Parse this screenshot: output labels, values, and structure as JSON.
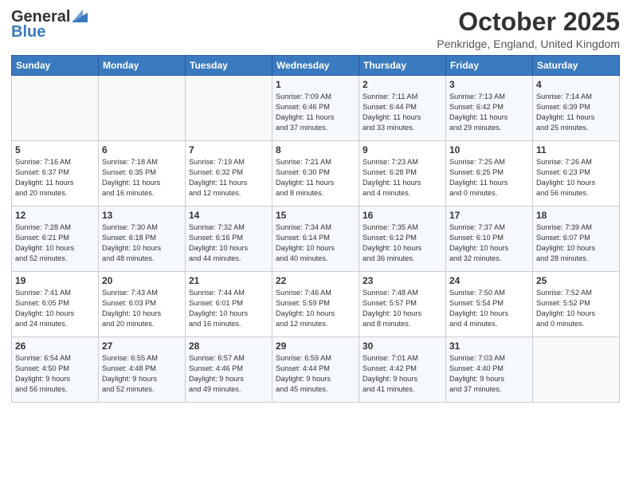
{
  "header": {
    "logo_general": "General",
    "logo_blue": "Blue",
    "month_title": "October 2025",
    "location": "Penkridge, England, United Kingdom"
  },
  "weekdays": [
    "Sunday",
    "Monday",
    "Tuesday",
    "Wednesday",
    "Thursday",
    "Friday",
    "Saturday"
  ],
  "weeks": [
    [
      {
        "day": "",
        "info": ""
      },
      {
        "day": "",
        "info": ""
      },
      {
        "day": "",
        "info": ""
      },
      {
        "day": "1",
        "info": "Sunrise: 7:09 AM\nSunset: 6:46 PM\nDaylight: 11 hours\nand 37 minutes."
      },
      {
        "day": "2",
        "info": "Sunrise: 7:11 AM\nSunset: 6:44 PM\nDaylight: 11 hours\nand 33 minutes."
      },
      {
        "day": "3",
        "info": "Sunrise: 7:13 AM\nSunset: 6:42 PM\nDaylight: 11 hours\nand 29 minutes."
      },
      {
        "day": "4",
        "info": "Sunrise: 7:14 AM\nSunset: 6:39 PM\nDaylight: 11 hours\nand 25 minutes."
      }
    ],
    [
      {
        "day": "5",
        "info": "Sunrise: 7:16 AM\nSunset: 6:37 PM\nDaylight: 11 hours\nand 20 minutes."
      },
      {
        "day": "6",
        "info": "Sunrise: 7:18 AM\nSunset: 6:35 PM\nDaylight: 11 hours\nand 16 minutes."
      },
      {
        "day": "7",
        "info": "Sunrise: 7:19 AM\nSunset: 6:32 PM\nDaylight: 11 hours\nand 12 minutes."
      },
      {
        "day": "8",
        "info": "Sunrise: 7:21 AM\nSunset: 6:30 PM\nDaylight: 11 hours\nand 8 minutes."
      },
      {
        "day": "9",
        "info": "Sunrise: 7:23 AM\nSunset: 6:28 PM\nDaylight: 11 hours\nand 4 minutes."
      },
      {
        "day": "10",
        "info": "Sunrise: 7:25 AM\nSunset: 6:25 PM\nDaylight: 11 hours\nand 0 minutes."
      },
      {
        "day": "11",
        "info": "Sunrise: 7:26 AM\nSunset: 6:23 PM\nDaylight: 10 hours\nand 56 minutes."
      }
    ],
    [
      {
        "day": "12",
        "info": "Sunrise: 7:28 AM\nSunset: 6:21 PM\nDaylight: 10 hours\nand 52 minutes."
      },
      {
        "day": "13",
        "info": "Sunrise: 7:30 AM\nSunset: 6:18 PM\nDaylight: 10 hours\nand 48 minutes."
      },
      {
        "day": "14",
        "info": "Sunrise: 7:32 AM\nSunset: 6:16 PM\nDaylight: 10 hours\nand 44 minutes."
      },
      {
        "day": "15",
        "info": "Sunrise: 7:34 AM\nSunset: 6:14 PM\nDaylight: 10 hours\nand 40 minutes."
      },
      {
        "day": "16",
        "info": "Sunrise: 7:35 AM\nSunset: 6:12 PM\nDaylight: 10 hours\nand 36 minutes."
      },
      {
        "day": "17",
        "info": "Sunrise: 7:37 AM\nSunset: 6:10 PM\nDaylight: 10 hours\nand 32 minutes."
      },
      {
        "day": "18",
        "info": "Sunrise: 7:39 AM\nSunset: 6:07 PM\nDaylight: 10 hours\nand 28 minutes."
      }
    ],
    [
      {
        "day": "19",
        "info": "Sunrise: 7:41 AM\nSunset: 6:05 PM\nDaylight: 10 hours\nand 24 minutes."
      },
      {
        "day": "20",
        "info": "Sunrise: 7:43 AM\nSunset: 6:03 PM\nDaylight: 10 hours\nand 20 minutes."
      },
      {
        "day": "21",
        "info": "Sunrise: 7:44 AM\nSunset: 6:01 PM\nDaylight: 10 hours\nand 16 minutes."
      },
      {
        "day": "22",
        "info": "Sunrise: 7:46 AM\nSunset: 5:59 PM\nDaylight: 10 hours\nand 12 minutes."
      },
      {
        "day": "23",
        "info": "Sunrise: 7:48 AM\nSunset: 5:57 PM\nDaylight: 10 hours\nand 8 minutes."
      },
      {
        "day": "24",
        "info": "Sunrise: 7:50 AM\nSunset: 5:54 PM\nDaylight: 10 hours\nand 4 minutes."
      },
      {
        "day": "25",
        "info": "Sunrise: 7:52 AM\nSunset: 5:52 PM\nDaylight: 10 hours\nand 0 minutes."
      }
    ],
    [
      {
        "day": "26",
        "info": "Sunrise: 6:54 AM\nSunset: 4:50 PM\nDaylight: 9 hours\nand 56 minutes."
      },
      {
        "day": "27",
        "info": "Sunrise: 6:55 AM\nSunset: 4:48 PM\nDaylight: 9 hours\nand 52 minutes."
      },
      {
        "day": "28",
        "info": "Sunrise: 6:57 AM\nSunset: 4:46 PM\nDaylight: 9 hours\nand 49 minutes."
      },
      {
        "day": "29",
        "info": "Sunrise: 6:59 AM\nSunset: 4:44 PM\nDaylight: 9 hours\nand 45 minutes."
      },
      {
        "day": "30",
        "info": "Sunrise: 7:01 AM\nSunset: 4:42 PM\nDaylight: 9 hours\nand 41 minutes."
      },
      {
        "day": "31",
        "info": "Sunrise: 7:03 AM\nSunset: 4:40 PM\nDaylight: 9 hours\nand 37 minutes."
      },
      {
        "day": "",
        "info": ""
      }
    ]
  ]
}
